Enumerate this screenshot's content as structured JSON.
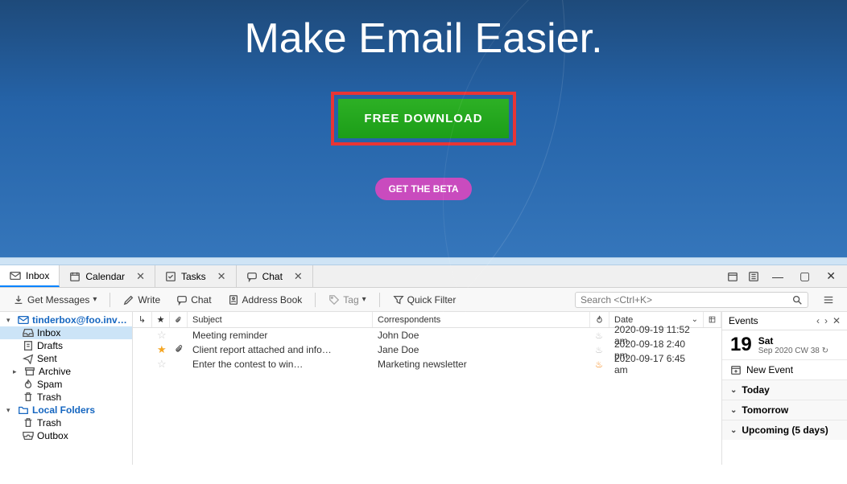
{
  "hero": {
    "title": "Make Email Easier.",
    "download": "FREE DOWNLOAD",
    "beta": "GET THE BETA"
  },
  "tabs": [
    {
      "icon": "mail",
      "label": "Inbox",
      "closable": false,
      "active": true
    },
    {
      "icon": "calendar",
      "label": "Calendar",
      "closable": true,
      "active": false
    },
    {
      "icon": "tasks",
      "label": "Tasks",
      "closable": true,
      "active": false
    },
    {
      "icon": "chat",
      "label": "Chat",
      "closable": true,
      "active": false
    }
  ],
  "toolbar": {
    "get_messages": "Get Messages",
    "write": "Write",
    "chat": "Chat",
    "address_book": "Address Book",
    "tag": "Tag",
    "quick_filter": "Quick Filter",
    "search_placeholder": "Search <Ctrl+K>"
  },
  "tree": {
    "account": "tinderbox@foo.invalid",
    "items": [
      {
        "icon": "inbox",
        "label": "Inbox",
        "selected": true
      },
      {
        "icon": "draft",
        "label": "Drafts",
        "selected": false
      },
      {
        "icon": "sent",
        "label": "Sent",
        "selected": false
      },
      {
        "icon": "archive",
        "label": "Archive",
        "selected": false,
        "has_children": true
      },
      {
        "icon": "spam",
        "label": "Spam",
        "selected": false
      },
      {
        "icon": "trash",
        "label": "Trash",
        "selected": false
      }
    ],
    "local_label": "Local Folders",
    "local": [
      {
        "icon": "trash",
        "label": "Trash"
      },
      {
        "icon": "outbox",
        "label": "Outbox"
      }
    ]
  },
  "columns": {
    "subject": "Subject",
    "correspondents": "Correspondents",
    "date": "Date"
  },
  "messages": [
    {
      "star": false,
      "attach": false,
      "subject": "Meeting reminder",
      "from": "John Doe",
      "hot": false,
      "date": "2020-09-19 11:52 am"
    },
    {
      "star": true,
      "attach": true,
      "subject": "Client report attached and info…",
      "from": "Jane Doe",
      "hot": false,
      "date": "2020-09-18 2:40 pm"
    },
    {
      "star": false,
      "attach": false,
      "subject": "Enter the contest to win…",
      "from": "Marketing newsletter",
      "hot": true,
      "date": "2020-09-17 6:45 am"
    }
  ],
  "events": {
    "title": "Events",
    "day": "19",
    "weekday": "Sat",
    "subdate": "Sep 2020  CW 38",
    "new_event": "New Event",
    "sections": [
      "Today",
      "Tomorrow",
      "Upcoming (5 days)"
    ]
  }
}
